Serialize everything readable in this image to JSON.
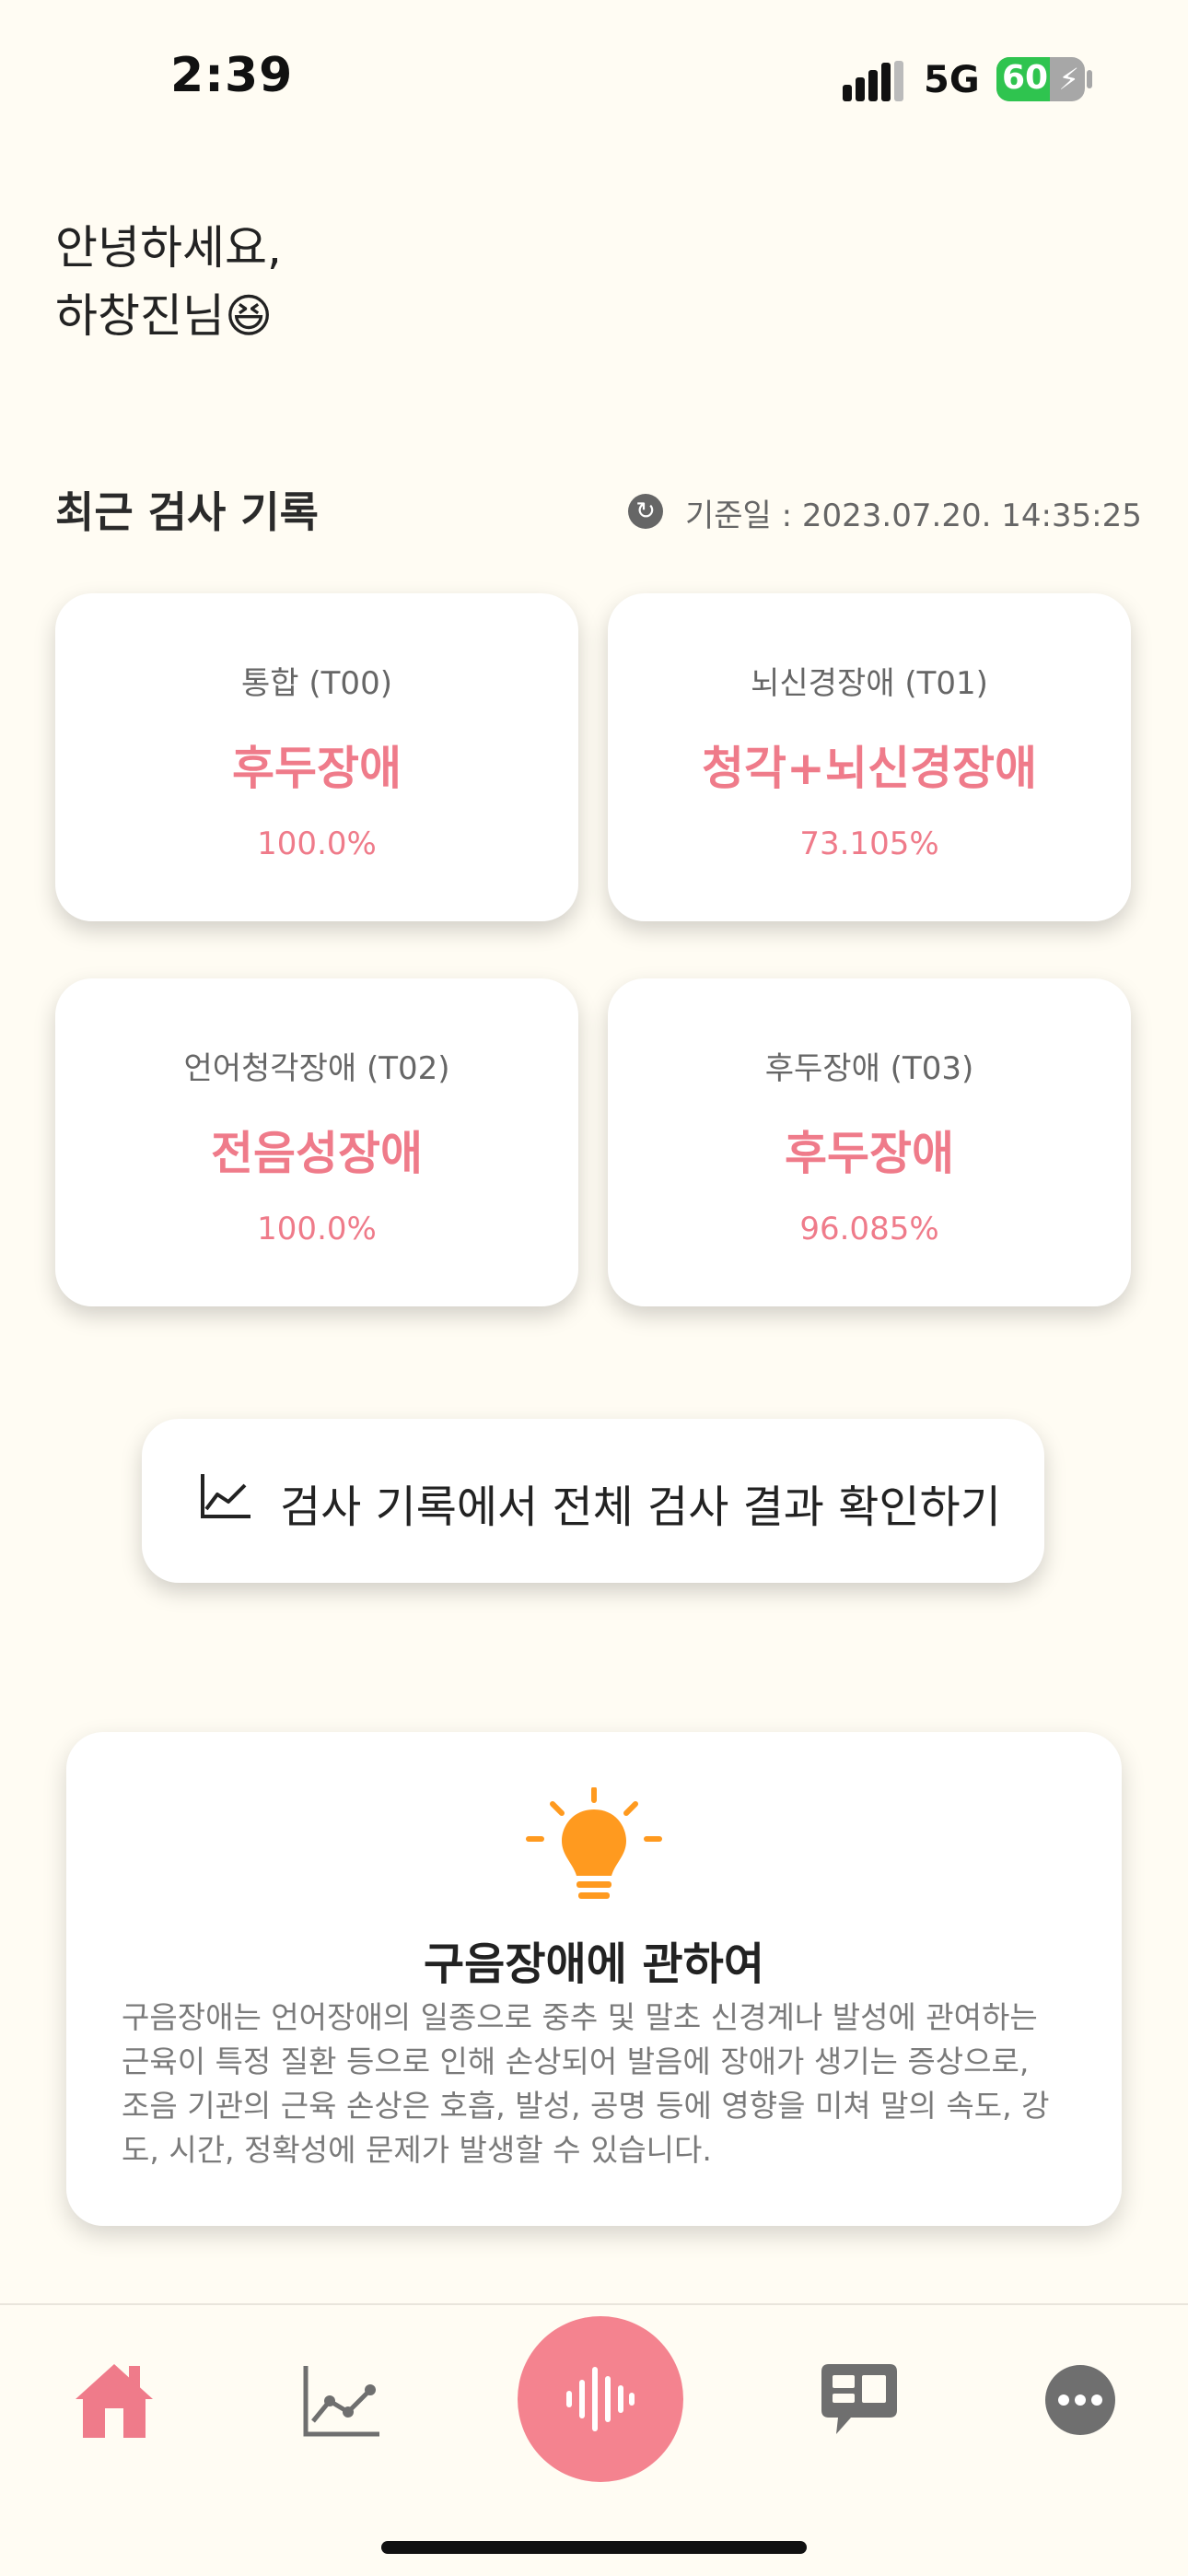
{
  "status_bar": {
    "time": "2:39",
    "network": "5G",
    "battery": "60",
    "battery_level": 0.6
  },
  "greeting": {
    "line1": "안녕하세요,",
    "line2": "하창진님😆"
  },
  "recent": {
    "title": "최근 검사 기록",
    "base_date": "기준일 : 2023.07.20. 14:35:25",
    "cards": [
      {
        "test": "통합 (T00)",
        "result": "후두장애",
        "percent": "100.0%"
      },
      {
        "test": "뇌신경장애 (T01)",
        "result": "청각+뇌신경장애",
        "percent": "73.105%"
      },
      {
        "test": "언어청각장애 (T02)",
        "result": "전음성장애",
        "percent": "100.0%"
      },
      {
        "test": "후두장애 (T03)",
        "result": "후두장애",
        "percent": "96.085%"
      }
    ]
  },
  "history_button": {
    "label": "검사 기록에서 전체 검사 결과 확인하기",
    "icon": "line-chart-icon"
  },
  "info": {
    "icon": "lightbulb-icon",
    "title": "구음장애에 관하여",
    "body": "구음장애는 언어장애의 일종으로 중추 및 말초 신경계나 발성에 관여하는 근육이 특정 질환 등으로 인해 손상되어 발음에 장애가 생기는 증상으로, 조음 기관의 근육 손상은 호흡, 발성, 공명 등에 영향을 미쳐 말의 속도, 강도, 시간, 정확성에 문제가 발생할 수 있습니다."
  },
  "nav": {
    "items": [
      "home-icon",
      "chart-icon",
      "voice-record-icon",
      "chat-icon",
      "more-icon"
    ],
    "active": "home-icon"
  },
  "colors": {
    "accent": "#ef7b8a",
    "background": "#fffcf3",
    "bulb": "#ff9a1f",
    "icon_gray": "#6f6f6f"
  }
}
